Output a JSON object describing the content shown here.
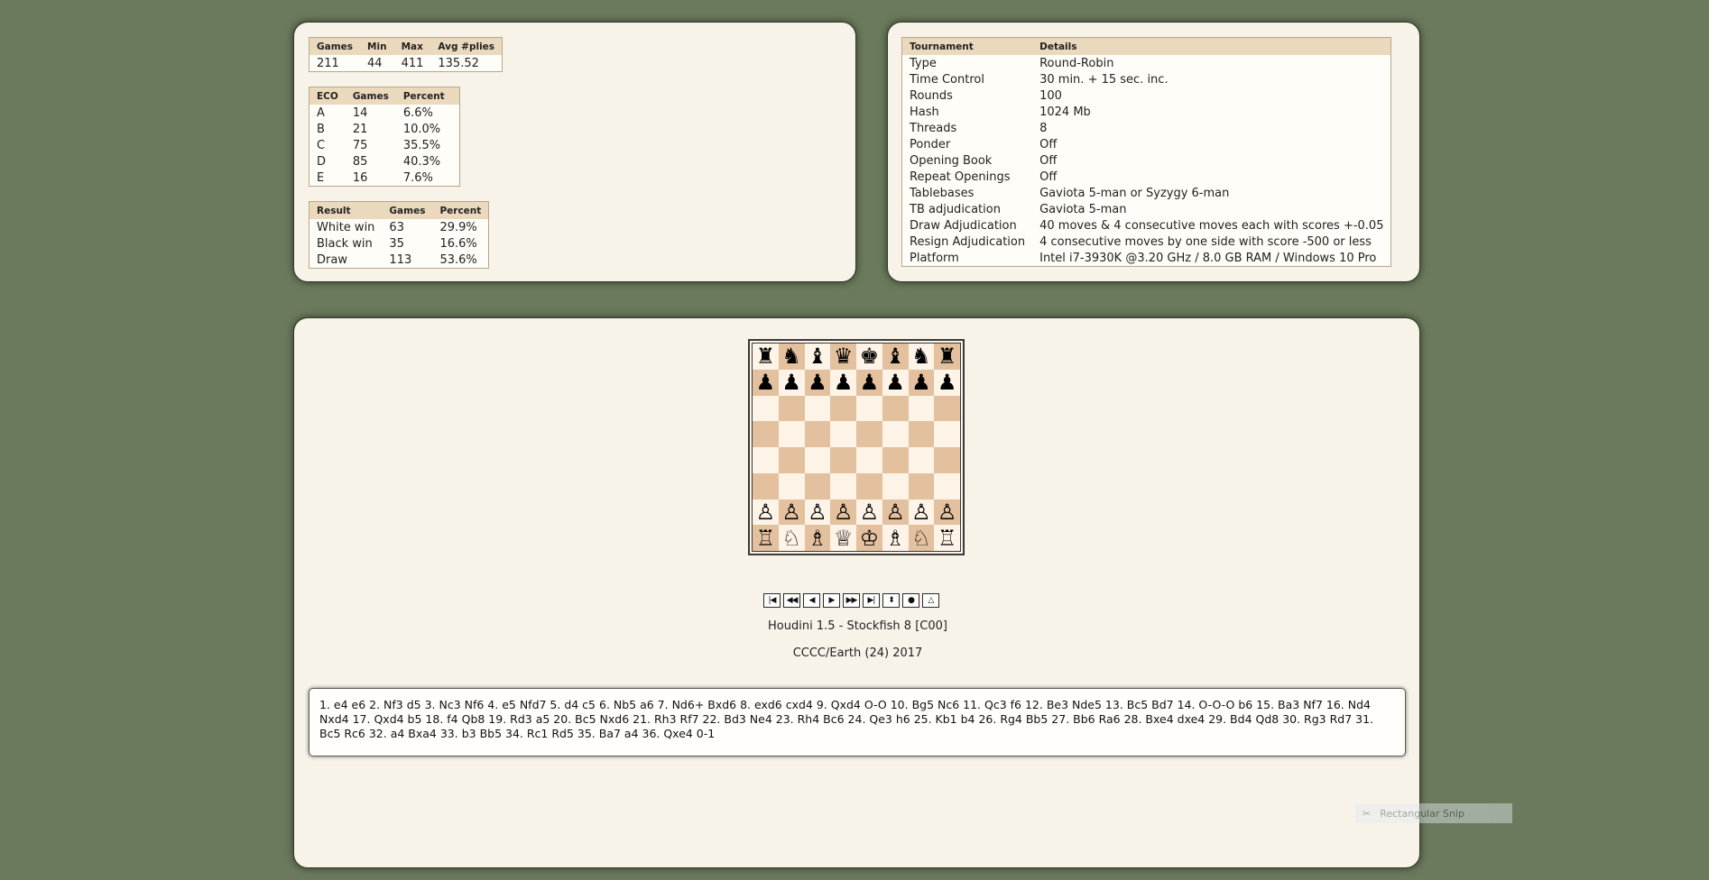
{
  "summary": {
    "headers": [
      "Games",
      "Min",
      "Max",
      "Avg #plies"
    ],
    "row": [
      "211",
      "44",
      "411",
      "135.52"
    ]
  },
  "eco": {
    "headers": [
      "ECO",
      "Games",
      "Percent"
    ],
    "rows": [
      [
        "A",
        "14",
        "6.6%"
      ],
      [
        "B",
        "21",
        "10.0%"
      ],
      [
        "C",
        "75",
        "35.5%"
      ],
      [
        "D",
        "85",
        "40.3%"
      ],
      [
        "E",
        "16",
        "7.6%"
      ]
    ]
  },
  "results": {
    "headers": [
      "Result",
      "Games",
      "Percent"
    ],
    "rows": [
      [
        "White win",
        "63",
        "29.9%"
      ],
      [
        "Black win",
        "35",
        "16.6%"
      ],
      [
        "Draw",
        "113",
        "53.6%"
      ]
    ]
  },
  "tournament": {
    "headers": [
      "Tournament",
      "Details"
    ],
    "rows": [
      [
        "Type",
        "Round-Robin"
      ],
      [
        "Time Control",
        "30 min. + 15 sec. inc."
      ],
      [
        "Rounds",
        "100"
      ],
      [
        "Hash",
        "1024 Mb"
      ],
      [
        "Threads",
        "8"
      ],
      [
        "Ponder",
        "Off"
      ],
      [
        "Opening Book",
        "Off"
      ],
      [
        "Repeat Openings",
        "Off"
      ],
      [
        "Tablebases",
        "Gaviota 5-man or Syzygy 6-man"
      ],
      [
        "TB adjudication",
        "Gaviota 5-man"
      ],
      [
        "Draw Adjudication",
        "40 moves & 4 consecutive moves each with scores +-0.05"
      ],
      [
        "Resign Adjudication",
        "4 consecutive moves by one side with score -500 or less"
      ],
      [
        "Platform",
        "Intel i7-3930K @3.20 GHz / 8.0 GB RAM / Windows 10 Pro"
      ]
    ]
  },
  "board": {
    "rows": [
      [
        "♜",
        "♞",
        "♝",
        "♛",
        "♚",
        "♝",
        "♞",
        "♜"
      ],
      [
        "♟",
        "♟",
        "♟",
        "♟",
        "♟",
        "♟",
        "♟",
        "♟"
      ],
      [
        "",
        "",
        "",
        "",
        "",
        "",
        "",
        ""
      ],
      [
        "",
        "",
        "",
        "",
        "",
        "",
        "",
        ""
      ],
      [
        "",
        "",
        "",
        "",
        "",
        "",
        "",
        ""
      ],
      [
        "",
        "",
        "",
        "",
        "",
        "",
        "",
        ""
      ],
      [
        "♙",
        "♙",
        "♙",
        "♙",
        "♙",
        "♙",
        "♙",
        "♙"
      ],
      [
        "♖",
        "♘",
        "♗",
        "♕",
        "♔",
        "♗",
        "♘",
        "♖"
      ]
    ]
  },
  "nav": {
    "buttons": [
      {
        "name": "first-move-button",
        "glyph": "|◀"
      },
      {
        "name": "back-multiple-button",
        "glyph": "◀◀"
      },
      {
        "name": "back-button",
        "glyph": "◀"
      },
      {
        "name": "play-button",
        "glyph": "▶"
      },
      {
        "name": "forward-multiple-button",
        "glyph": "▶▶"
      },
      {
        "name": "last-move-button",
        "glyph": "▶|"
      },
      {
        "name": "flip-board-button",
        "glyph": "⬍"
      },
      {
        "name": "autoplay-button",
        "glyph": "●"
      },
      {
        "name": "options-button",
        "glyph": "△"
      }
    ]
  },
  "game": {
    "title": "Houdini 1.5 - Stockfish 8 [C00]",
    "event": "CCCC/Earth (24) 2017",
    "moves": "1. e4 e6 2. Nf3 d5 3. Nc3 Nf6 4. e5 Nfd7 5. d4 c5 6. Nb5 a6 7. Nd6+ Bxd6 8. exd6 cxd4 9. Qxd4 O-O 10. Bg5 Nc6 11. Qc3 f6 12. Be3 Nde5 13. Bc5 Bd7 14. O-O-O b6 15. Ba3 Nf7 16. Nd4 Nxd4 17. Qxd4 b5 18. f4 Qb8 19. Rd3 a5 20. Bc5 Nxd6 21. Rh3 Rf7 22. Bd3 Ne4 23. Rh4 Bc6 24. Qe3 h6 25. Kb1 b4 26. Rg4 Bb5 27. Bb6 Ra6 28. Bxe4 dxe4 29. Bd4 Qd8 30. Rg3 Rd7 31. Bc5 Rc6 32. a4 Bxa4 33. b3 Bb5 34. Rc1 Rd5 35. Ba7 a4 36. Qxe4 0-1"
  },
  "overlay": {
    "label": "Rectangular Snip"
  }
}
